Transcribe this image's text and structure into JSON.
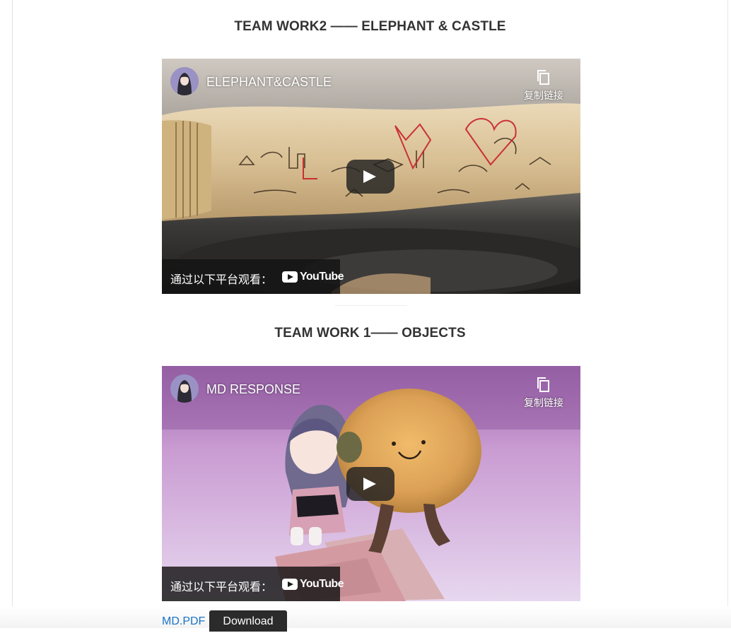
{
  "sections": [
    {
      "title": "TEAM WORK2 —— ELEPHANT & CASTLE",
      "video": {
        "title": "ELEPHANT&CASTLE",
        "copy_link_label": "复制链接",
        "watch_on_label": "通过以下平台观看：",
        "platform": "YouTube"
      }
    },
    {
      "title": "TEAM WORK 1—— OBJECTS",
      "video": {
        "title": "MD RESPONSE",
        "copy_link_label": "复制链接",
        "watch_on_label": "通过以下平台观看：",
        "platform": "YouTube"
      }
    }
  ],
  "attachment": {
    "file_link": "MD.PDF",
    "download_label": "Download"
  },
  "colors": {
    "link": "#1a73c8",
    "download_button": "#2b2b2b",
    "title_text": "#333333"
  },
  "icons": [
    "copy-icon",
    "play-icon",
    "youtube-logo-icon"
  ]
}
